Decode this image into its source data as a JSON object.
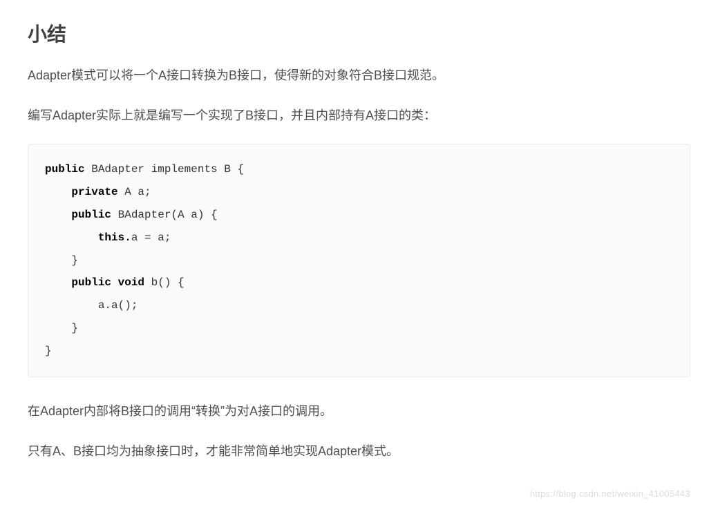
{
  "heading": "小结",
  "paragraph1": "Adapter模式可以将一个A接口转换为B接口，使得新的对象符合B接口规范。",
  "paragraph2": "编写Adapter实际上就是编写一个实现了B接口，并且内部持有A接口的类：",
  "code": {
    "l1_kw": "public",
    "l1_rest": " BAdapter implements B {",
    "l2_kw": "private",
    "l2_rest": " A a;",
    "l3_kw": "public",
    "l3_rest": " BAdapter(A a) {",
    "l4_kw": "this.",
    "l4_rest": "a = a;",
    "l5": "    }",
    "l6_kw": "public void",
    "l6_rest": " b() {",
    "l7": "        a.a();",
    "l8": "    }",
    "l9": "}"
  },
  "paragraph3": "在Adapter内部将B接口的调用“转换”为对A接口的调用。",
  "paragraph4": "只有A、B接口均为抽象接口时，才能非常简单地实现Adapter模式。",
  "watermark": "https://blog.csdn.net/weixin_41005443"
}
